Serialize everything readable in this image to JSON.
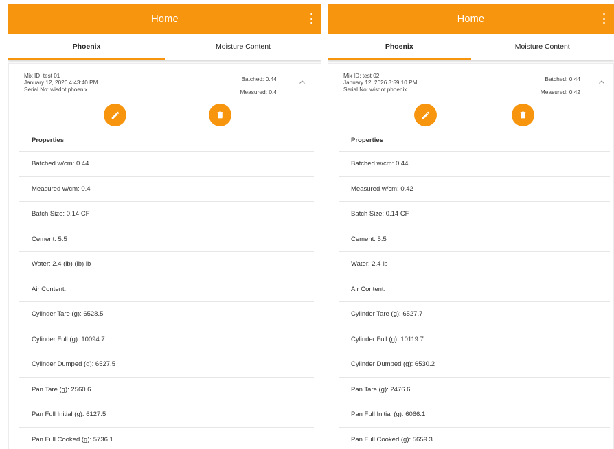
{
  "app": {
    "title": "Home"
  },
  "tabs": [
    "Phoenix",
    "Moisture Content"
  ],
  "panels": [
    {
      "mix_id": "Mix ID: test 01",
      "date": "January 12, 2026 4:43:40 PM",
      "serial": "Serial No: wisdot phoenix",
      "batched": "Batched: 0.44",
      "measured": "Measured: 0.4",
      "properties_header": "Properties",
      "rows": [
        "Batched w/cm: 0.44",
        "Measured w/cm: 0.4",
        "Batch Size: 0.14 CF",
        "Cement: 5.5",
        "Water: 2.4 (lb) (lb) lb",
        "Air Content:",
        "Cylinder Tare (g): 6528.5",
        "Cylinder Full (g): 10094.7",
        "Cylinder Dumped (g): 6527.5",
        "Pan Tare (g): 2560.6",
        "Pan Full Initial (g): 6127.5",
        "Pan Full Cooked (g): 5736.1"
      ]
    },
    {
      "mix_id": "Mix ID: test 02",
      "date": "January 12, 2026 3:59:10 PM",
      "serial": "Serial No: wisdot phoenix",
      "batched": "Batched: 0.44",
      "measured": "Measured: 0.42",
      "properties_header": "Properties",
      "rows": [
        "Batched w/cm: 0.44",
        "Measured w/cm: 0.42",
        "Batch Size: 0.14 CF",
        "Cement: 5.5",
        "Water: 2.4 lb",
        "Air Content:",
        "Cylinder Tare (g): 6527.7",
        "Cylinder Full (g): 10119.7",
        "Cylinder Dumped (g): 6530.2",
        "Pan Tare (g): 2476.6",
        "Pan Full Initial (g): 6066.1",
        "Pan Full Cooked (g): 5659.3"
      ]
    }
  ],
  "colors": {
    "accent": "#f7950e",
    "text": "#333333",
    "divider": "#e6e6e6"
  },
  "icons": {
    "menu": "more-vert-icon",
    "edit": "pencil-icon",
    "delete": "trash-icon",
    "collapse": "chevron-up-icon"
  }
}
